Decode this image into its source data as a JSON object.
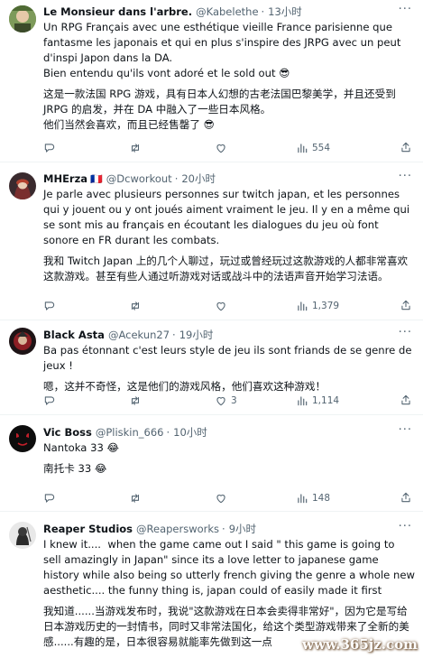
{
  "tweets": [
    {
      "name": "Le Monsieur dans l'arbre.",
      "handle": "@Kabelethe",
      "time": "13小时",
      "text_fr": "Un RPG Français avec une esthétique vieille France parisienne que fantasme les japonais et qui en plus s'inspire des JRPG avec un peut d'inspi Japon dans la DA.\nBien entendu qu'ils vont adoré et le sold out 😎",
      "text_zh": "这是一款法国 RPG 游戏，具有日本人幻想的古老法国巴黎美学，并且还受到 JRPG 的启发，并在 DA 中融入了一些日本风格。\n他们当然会喜欢，而且已经售罄了 😎",
      "replies": "",
      "retweets": "",
      "likes": "",
      "views": "554"
    },
    {
      "name": "MHErza",
      "flag": "🇫🇷",
      "handle": "@Dcworkout",
      "time": "20小时",
      "text_fr": "Je parle avec plusieurs personnes sur twitch japan, et les personnes qui y jouent ou y ont joués aiment vraiment le jeu. Il y en a même qui se sont mis au français en écoutant les dialogues du jeu où font sonore en FR durant les combats.",
      "text_zh": "我和 Twitch Japan 上的几个人聊过，玩过或曾经玩过这款游戏的人都非常喜欢这款游戏。甚至有些人通过听游戏对话或战斗中的法语声音开始学习法语。",
      "replies": "",
      "retweets": "",
      "likes": "",
      "views": "1,379"
    },
    {
      "name": "Black Asta",
      "handle": "@Acekun27",
      "time": "19小时",
      "text_fr": "Ba pas étonnant c'est leurs style de jeu ils sont friands de se genre de jeux !",
      "text_zh": "嗯，这并不奇怪，这是他们的游戏风格，他们喜欢这种游戏！",
      "replies": "",
      "retweets": "",
      "likes": "3",
      "views": "1,114"
    },
    {
      "name": "Vic Boss",
      "handle": "@Pliskin_666",
      "time": "10小时",
      "text_fr": "Nantoka 33 😂",
      "text_zh": "南托卡 33 😂",
      "replies": "",
      "retweets": "",
      "likes": "",
      "views": "148"
    },
    {
      "name": "Reaper Studios",
      "handle": "@Reapersworks",
      "time": "9小时",
      "text_fr": "I knew it....  when the game came out I said \" this game is going to sell amazingly in Japan\" since its a love letter to japanese game history while also being so utterly french giving the genre a whole new aesthetic.... the funny thing is, japan could of easily made it first",
      "text_zh": "我知道......当游戏发布时，我说\"这款游戏在日本会卖得非常好\"，因为它是写给日本游戏历史的一封情书，同时又非常法国化，给这个类型游戏带来了全新的美感......有趣的是，日本很容易就能率先做到这一点"
    }
  ],
  "watermark": "www.365jz.com",
  "colors": {
    "text": "#0f1419",
    "muted": "#536471",
    "divider": "#eff3f4"
  }
}
